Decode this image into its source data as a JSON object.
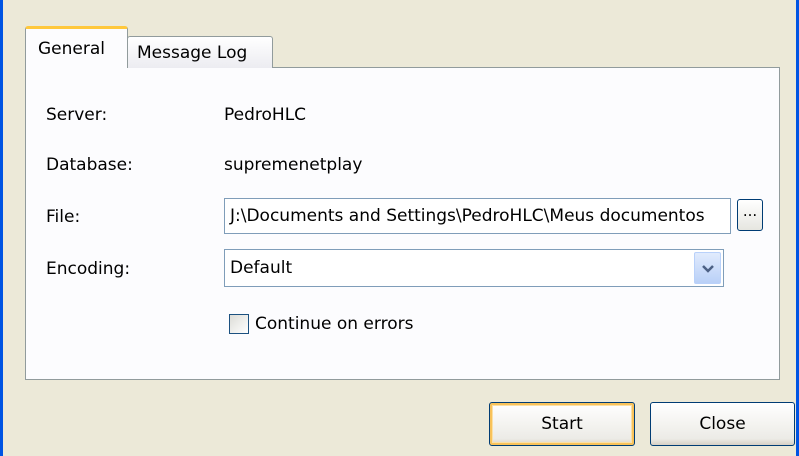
{
  "tabs": [
    {
      "label": "General",
      "active": true
    },
    {
      "label": "Message Log",
      "active": false
    }
  ],
  "fields": {
    "server_label": "Server:",
    "server_value": "PedroHLC",
    "database_label": "Database:",
    "database_value": "supremenetplay",
    "file_label": "File:",
    "file_value": "J:\\Documents and Settings\\PedroHLC\\Meus documentos",
    "browse_label": "...",
    "encoding_label": "Encoding:",
    "encoding_value": "Default"
  },
  "options": {
    "continue_on_errors_label": "Continue on errors",
    "continue_on_errors_checked": false
  },
  "buttons": {
    "start_label": "Start",
    "close_label": "Close"
  },
  "colors": {
    "dialog_bg": "#ece9d8",
    "panel_bg": "#fcfcfe",
    "active_tab_accent": "#ffc83c",
    "window_frame": "#0054e3"
  },
  "icons": {
    "dropdown": "chevron-down-icon"
  }
}
